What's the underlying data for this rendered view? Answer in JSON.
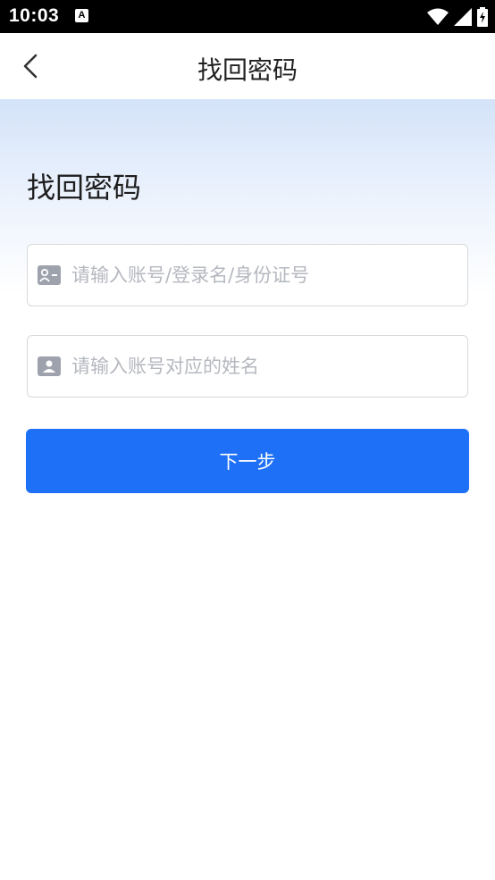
{
  "status_bar": {
    "time": "10:03",
    "notification_glyph": "A",
    "icons": [
      "wifi-icon",
      "signal-icon",
      "battery-charging-icon"
    ]
  },
  "nav": {
    "title": "找回密码",
    "back_icon": "chevron-left-icon"
  },
  "page": {
    "heading": "找回密码"
  },
  "form": {
    "account_field": {
      "value": "",
      "placeholder": "请输入账号/登录名/身份证号",
      "icon": "contact-card-icon"
    },
    "name_field": {
      "value": "",
      "placeholder": "请输入账号对应的姓名",
      "icon": "person-badge-icon"
    },
    "next_label": "下一步"
  },
  "colors": {
    "primary": "#1e71f6",
    "hero_gradient_top": "#d4e3f9",
    "placeholder": "#b5b8bf",
    "icon_gray": "#9ea2ad"
  }
}
